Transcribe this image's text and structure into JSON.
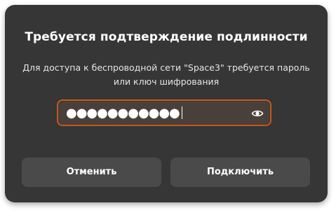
{
  "dialog": {
    "title": "Требуется подтверждение подлинности",
    "description_line1": "Для доступа к беспроводной сети \"Space3\" требуется пароль",
    "description_line2": "или ключ шифрования",
    "password_value": "●●●●●●●●●●●",
    "show_password_icon": "eye-icon",
    "cancel_label": "Отменить",
    "connect_label": "Подключить"
  },
  "colors": {
    "dialog_bg": "#363636",
    "button_bg": "#4a4a4a",
    "focus_border": "#c45a1d"
  }
}
